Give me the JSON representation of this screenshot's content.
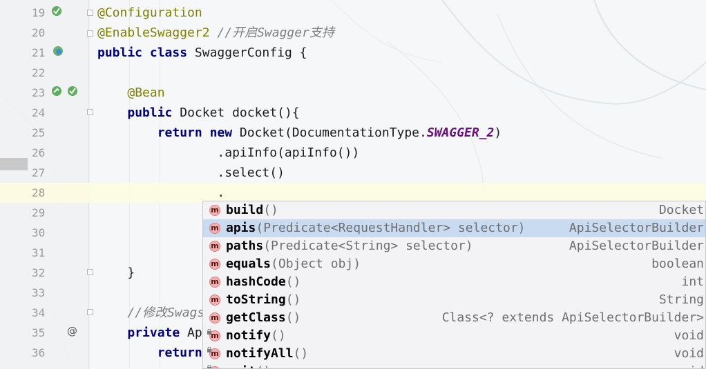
{
  "editor": {
    "lines": [
      {
        "num": "19",
        "parts": [
          {
            "t": "@Configuration",
            "c": "ann"
          }
        ]
      },
      {
        "num": "20",
        "parts": [
          {
            "t": "@EnableSwagger2",
            "c": "ann"
          },
          {
            "t": " "
          },
          {
            "t": "//开启Swagger支持",
            "c": "cm"
          }
        ]
      },
      {
        "num": "21",
        "parts": [
          {
            "t": "public",
            "c": "k"
          },
          {
            "t": " "
          },
          {
            "t": "class",
            "c": "k"
          },
          {
            "t": " SwaggerConfig {"
          }
        ]
      },
      {
        "num": "22",
        "parts": []
      },
      {
        "num": "23",
        "parts": [
          {
            "t": "    "
          },
          {
            "t": "@Bean",
            "c": "ann"
          }
        ]
      },
      {
        "num": "24",
        "parts": [
          {
            "t": "    "
          },
          {
            "t": "public",
            "c": "k"
          },
          {
            "t": " Docket docket(){"
          }
        ]
      },
      {
        "num": "25",
        "parts": [
          {
            "t": "        "
          },
          {
            "t": "return",
            "c": "k"
          },
          {
            "t": " "
          },
          {
            "t": "new",
            "c": "k"
          },
          {
            "t": " Docket(DocumentationType."
          },
          {
            "t": "SWAGGER_2",
            "c": "cn"
          },
          {
            "t": ")"
          }
        ]
      },
      {
        "num": "26",
        "parts": [
          {
            "t": "                .apiInfo(apiInfo())"
          }
        ]
      },
      {
        "num": "27",
        "parts": [
          {
            "t": "                .select()"
          }
        ]
      },
      {
        "num": "28",
        "parts": [
          {
            "t": "                ."
          }
        ]
      },
      {
        "num": "29",
        "parts": []
      },
      {
        "num": "30",
        "parts": []
      },
      {
        "num": "31",
        "parts": []
      },
      {
        "num": "32",
        "parts": [
          {
            "t": "    }"
          }
        ]
      },
      {
        "num": "33",
        "parts": []
      },
      {
        "num": "34",
        "parts": [
          {
            "t": "    "
          },
          {
            "t": "//修改Swags",
            "c": "cm"
          }
        ]
      },
      {
        "num": "35",
        "parts": [
          {
            "t": "    "
          },
          {
            "t": "private",
            "c": "k"
          },
          {
            "t": " Ap"
          }
        ]
      },
      {
        "num": "36",
        "parts": [
          {
            "t": "        "
          },
          {
            "t": "return",
            "c": "k"
          }
        ]
      }
    ]
  },
  "completion": {
    "items": [
      {
        "name": "build",
        "sig": "()",
        "type": "Docket",
        "icon": "method-icon",
        "locked": false
      },
      {
        "name": "apis",
        "sig": "(Predicate<RequestHandler> selector)",
        "type": "ApiSelectorBuilder",
        "icon": "method-icon",
        "locked": false,
        "selected": true
      },
      {
        "name": "paths",
        "sig": "(Predicate<String> selector)",
        "type": "ApiSelectorBuilder",
        "icon": "method-icon",
        "locked": false
      },
      {
        "name": "equals",
        "sig": "(Object obj)",
        "type": "boolean",
        "icon": "method-icon",
        "locked": false
      },
      {
        "name": "hashCode",
        "sig": "()",
        "type": "int",
        "icon": "method-icon",
        "locked": false
      },
      {
        "name": "toString",
        "sig": "()",
        "type": "String",
        "icon": "method-icon",
        "locked": false
      },
      {
        "name": "getClass",
        "sig": "()",
        "type": "Class<? extends ApiSelectorBuilder>",
        "icon": "method-icon",
        "locked": false
      },
      {
        "name": "notify",
        "sig": "()",
        "type": "void",
        "icon": "method-icon",
        "locked": true
      },
      {
        "name": "notifyAll",
        "sig": "()",
        "type": "void",
        "icon": "method-icon",
        "locked": true
      },
      {
        "name": "wait",
        "sig": "()",
        "type": "void",
        "icon": "method-icon",
        "locked": true
      }
    ]
  },
  "icons": {
    "line19": "bean-check-icon",
    "line21": "spring-config-icon",
    "line23": "bean-run-icon",
    "line35": "override-at-icon"
  },
  "colors": {
    "keyword": "#000080",
    "annotation": "#808000",
    "comment": "#808080",
    "constant": "#660e7a",
    "selection": "#c8dbf1"
  }
}
